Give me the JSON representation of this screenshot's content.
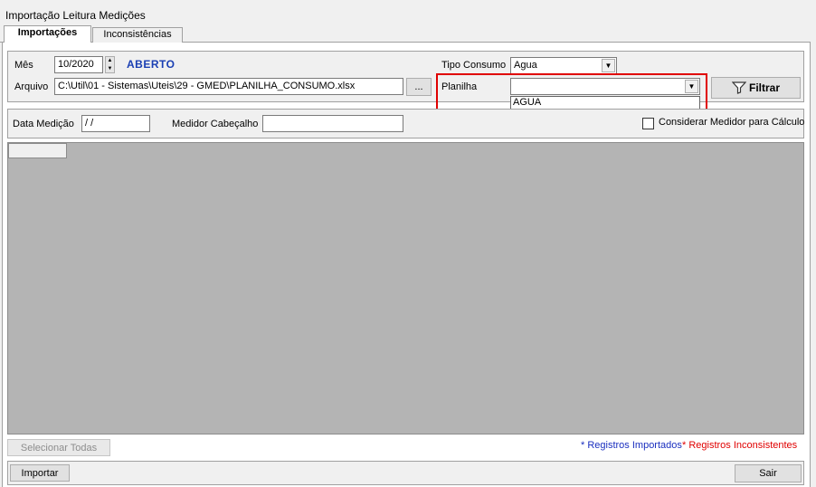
{
  "window": {
    "title": "Importação Leitura Medições"
  },
  "tabs": [
    {
      "label": "Importações",
      "active": true
    },
    {
      "label": "Inconsistências",
      "active": false
    }
  ],
  "filters": {
    "mes_label": "Mês",
    "mes_value": "10/2020",
    "status": "ABERTO",
    "arquivo_label": "Arquivo",
    "arquivo_value": "C:\\Util\\01 - Sistemas\\Uteis\\29 - GMED\\PLANILHA_CONSUMO.xlsx",
    "browse_label": "...",
    "tipo_consumo_label": "Tipo Consumo",
    "tipo_consumo_value": "Agua",
    "planilha_label": "Planilha",
    "planilha_value": "",
    "planilha_options": [
      "AGUA"
    ],
    "filtrar_label": "Filtrar"
  },
  "measurement": {
    "data_label": "Data Medição",
    "data_value": " /  /",
    "medidor_label": "Medidor Cabeçalho",
    "medidor_value": "",
    "considerar_label": "Considerar Medidor para Cálculo",
    "considerar_checked": false
  },
  "footer": {
    "selecionar_todas_label": "Selecionar Todas",
    "legend_imported": "* Registros Importados",
    "legend_inconsistent": "* Registros Inconsistentes",
    "importar_label": "Importar",
    "sair_label": "Sair"
  },
  "colors": {
    "status_blue": "#1a3fb3",
    "highlight_red": "#e00000",
    "grid_gray": "#b4b4b4"
  }
}
